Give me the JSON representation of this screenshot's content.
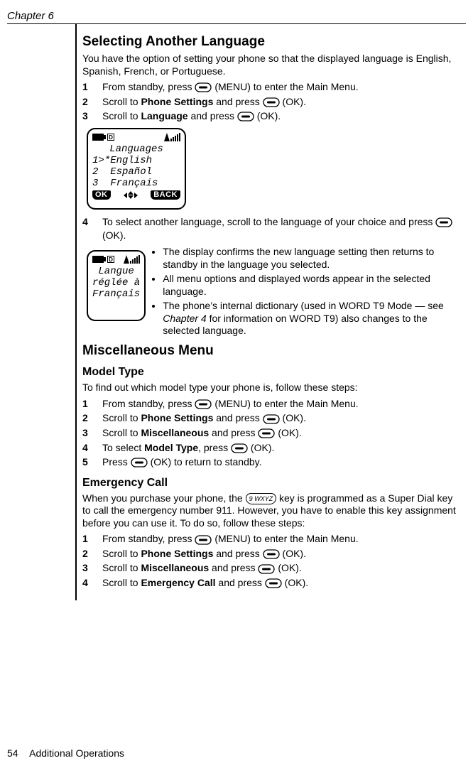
{
  "chapter": "Chapter 6",
  "footer_page": "54",
  "footer_title": "Additional Operations",
  "sec1": {
    "heading": "Selecting Another Language",
    "intro": "You have the option of setting your phone so that the displayed language is English, Spanish, French, or Portuguese.",
    "steps_a": {
      "n1": "1",
      "t1a": "From standby, press ",
      "t1b": " (MENU) to enter the Main Menu.",
      "n2": "2",
      "t2a": "Scroll to ",
      "t2b": "Phone Settings",
      "t2c": " and press ",
      "t2d": " (OK).",
      "n3": "3",
      "t3a": "Scroll to ",
      "t3b": "Language",
      "t3c": " and press ",
      "t3d": " (OK)."
    },
    "screen_a": {
      "title": "Languages",
      "row1": "1>*English",
      "row2": "2  Español",
      "row3": "3  Français",
      "ok": "OK",
      "back": "BACK"
    },
    "step4_num": "4",
    "step4_a": "To select another language, scroll to the language of your choice and press ",
    "step4_b": " (OK).",
    "screen_b": {
      "l1": "Langue",
      "l2": "réglée à",
      "l3": "Français"
    },
    "bullets": {
      "b1": "The display confirms the new language setting then returns to standby in the language you selected.",
      "b2": "All menu options and displayed words appear in the selected language.",
      "b3a": "The phone’s internal dictionary (used in WORD T9 Mode — see ",
      "b3b": "Chapter 4",
      "b3c": " for information on WORD T9) also changes to the selected language."
    }
  },
  "sec2": {
    "heading": "Miscellaneous Menu",
    "sub1": "Model Type",
    "intro1": "To find out which model type your phone is, follow these steps:",
    "steps_b": {
      "n1": "1",
      "t1a": "From standby, press ",
      "t1b": " (MENU) to enter the Main Menu.",
      "n2": "2",
      "t2a": "Scroll to ",
      "t2b": "Phone Settings",
      "t2c": " and press ",
      "t2d": " (OK).",
      "n3": "3",
      "t3a": "Scroll to ",
      "t3b": "Miscellaneous",
      "t3c": " and press ",
      "t3d": " (OK).",
      "n4": "4",
      "t4a": "To select ",
      "t4b": "Model Type",
      "t4c": ", press ",
      "t4d": " (OK).",
      "n5": "5",
      "t5a": "Press ",
      "t5b": " (OK) to return to standby."
    },
    "sub2": "Emergency Call",
    "intro2a": "When you purchase your phone, the ",
    "intro2_key": "9 WXYZ",
    "intro2b": " key is programmed as a Super Dial key to call the emergency number 911. However, you have to enable this key assignment before you can use it. To do so, follow these steps:",
    "steps_c": {
      "n1": "1",
      "t1a": "From standby, press ",
      "t1b": " (MENU) to enter the Main Menu.",
      "n2": "2",
      "t2a": "Scroll to ",
      "t2b": "Phone Settings",
      "t2c": " and press ",
      "t2d": " (OK).",
      "n3": "3",
      "t3a": "Scroll to ",
      "t3b": "Miscellaneous",
      "t3c": " and press ",
      "t3d": " (OK).",
      "n4": "4",
      "t4a": "Scroll to ",
      "t4b": "Emergency Call",
      "t4c": " and press ",
      "t4d": " (OK)."
    }
  }
}
